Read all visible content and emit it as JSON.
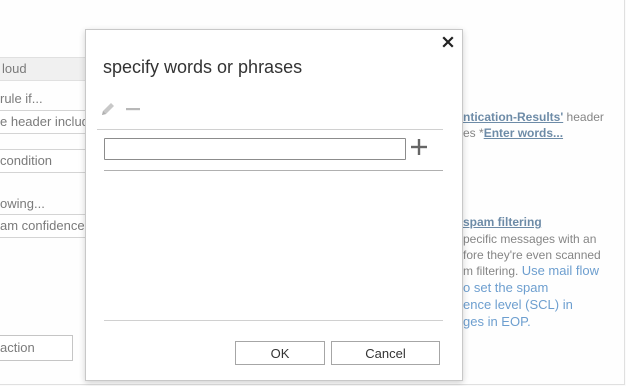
{
  "background": {
    "left_panel": {
      "cloud_label": "loud",
      "rule_if": "rule if...",
      "header_includes": "e header include",
      "condition": "condition",
      "following": "owing...",
      "spam_confidence": "am confidence le",
      "action_button": "action"
    },
    "right_panel": {
      "line1_link": "ntication-Results'",
      "line1_rest": "header",
      "line2_prefix": "es *",
      "line2_link": "Enter words...",
      "spam_filtering": "spam filtering",
      "desc1": "pecific messages with an",
      "desc2": "fore they're even scanned",
      "desc3_plain": "m filtering. ",
      "desc3_link": "Use mail flow",
      "desc4": "o set the spam",
      "desc5": "ence level (SCL) in",
      "desc6": "ges in EOP."
    }
  },
  "dialog": {
    "title": "specify words or phrases",
    "input": {
      "value": "",
      "placeholder": ""
    },
    "words": [],
    "ok_label": "OK",
    "cancel_label": "Cancel",
    "icons": {
      "close": "close-icon",
      "edit": "pencil-icon",
      "remove": "minus-icon",
      "add": "plus-icon"
    }
  }
}
